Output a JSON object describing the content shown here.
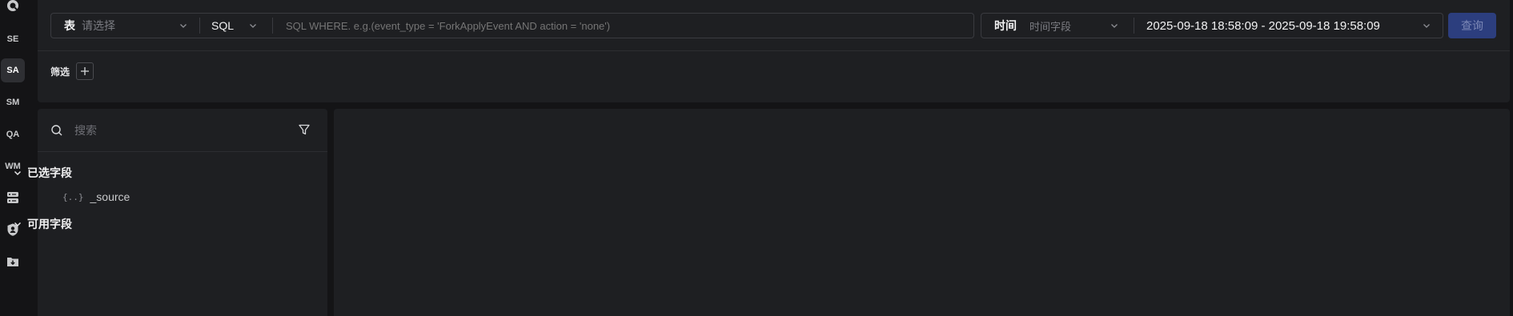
{
  "rail": {
    "items": [
      {
        "label": "SE"
      },
      {
        "label": "SA"
      },
      {
        "label": "SM"
      },
      {
        "label": "QA"
      },
      {
        "label": "WM"
      }
    ],
    "icons": [
      "query-logo-icon",
      "server-icon",
      "shield-user-icon",
      "folder-download-icon"
    ]
  },
  "query": {
    "table_label": "表",
    "table_placeholder": "请选择",
    "mode": "SQL",
    "where_placeholder": "SQL WHERE. e.g.(event_type = 'ForkApplyEvent AND action = 'none')",
    "time_label": "时间",
    "time_field_placeholder": "时间字段",
    "time_range": "2025-09-18 18:58:09 - 2025-09-18 19:58:09",
    "query_button": "查询"
  },
  "filter": {
    "label": "筛选"
  },
  "fields": {
    "search_placeholder": "搜索",
    "selected_group": "已选字段",
    "selected_items": [
      {
        "icon": "{..}",
        "name": "_source"
      }
    ],
    "available_group": "可用字段"
  },
  "colors": {
    "background": "#141416",
    "panel": "#1e1f22",
    "primary_button": "#2c3e7e"
  }
}
